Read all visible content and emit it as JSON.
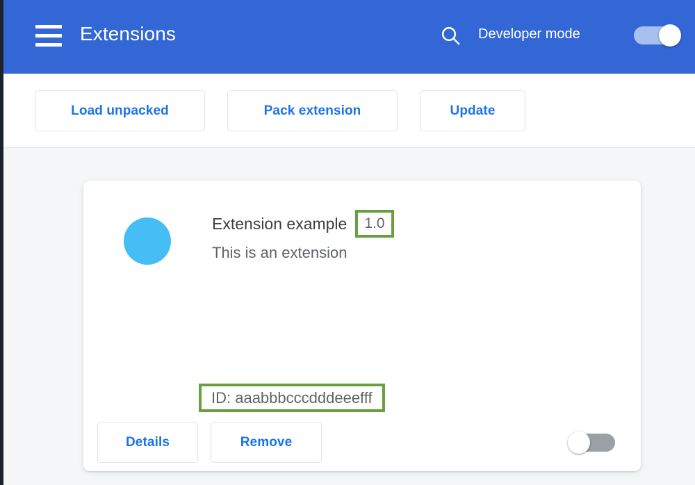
{
  "window": {
    "accent_blue": "#3367d6",
    "link_blue": "#1a73e8",
    "highlight_green": "#6a9f3f",
    "background": "#f5f6f8"
  },
  "header": {
    "title": "Extensions",
    "menu_icon": "hamburger-menu-icon",
    "search_icon": "search-icon",
    "developer_mode_label": "Developer mode",
    "developer_mode_toggle": {
      "state": "on",
      "track_color": "#a8c0ee",
      "knob_color": "#ffffff"
    }
  },
  "toolbar": {
    "buttons": [
      {
        "label": "Load unpacked",
        "name": "load-unpacked-button"
      },
      {
        "label": "Pack extension",
        "name": "pack-extension-button"
      },
      {
        "label": "Update",
        "name": "update-button"
      }
    ]
  },
  "extension_card": {
    "icon": {
      "name": "extension-icon",
      "color": "#45bdf5",
      "shape": "circle"
    },
    "name": "Extension example",
    "version": "1.0",
    "description": "This is an extension",
    "id_text": "ID: aaabbbcccdddeeefff",
    "buttons": [
      {
        "label": "Details",
        "name": "details-button"
      },
      {
        "label": "Remove",
        "name": "remove-button"
      }
    ],
    "enable_toggle": {
      "state": "off",
      "track_color": "#9aa0a6",
      "knob_color": "#ffffff"
    },
    "annotations": [
      {
        "target": "version",
        "color": "#6a9f3f",
        "style": "rectangle-outline"
      },
      {
        "target": "id_text",
        "color": "#6a9f3f",
        "style": "rectangle-outline"
      }
    ]
  }
}
